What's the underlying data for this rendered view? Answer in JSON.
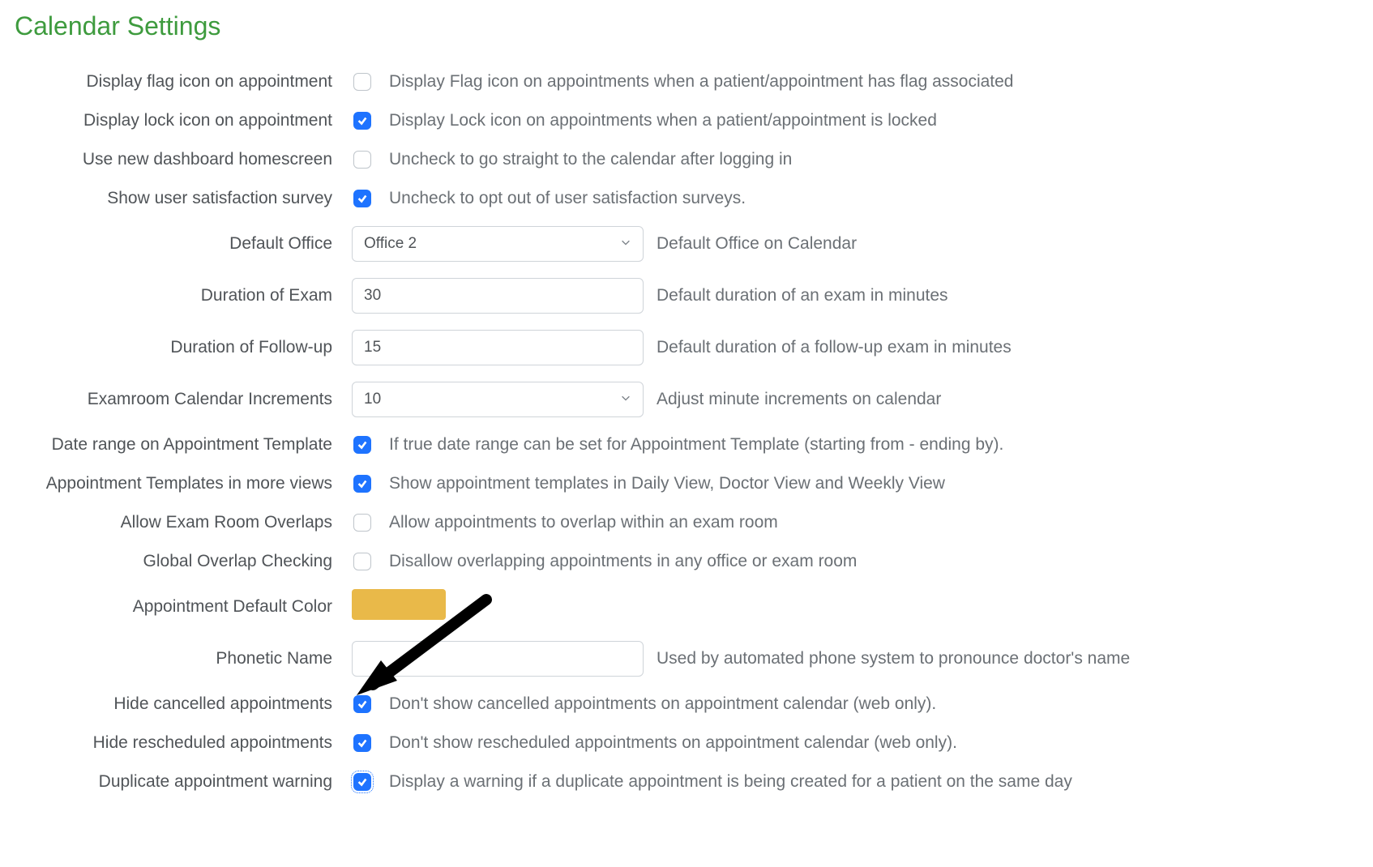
{
  "title": "Calendar Settings",
  "colors": {
    "accent": "#1e73ff",
    "title": "#3e9b3e",
    "swatch": "#e9b949"
  },
  "rows": {
    "flag": {
      "label": "Display flag icon on appointment",
      "checked": false,
      "desc": "Display Flag icon on appointments when a patient/appointment has flag associated"
    },
    "lock": {
      "label": "Display lock icon on appointment",
      "checked": true,
      "desc": "Display Lock icon on appointments when a patient/appointment is locked"
    },
    "dashboard": {
      "label": "Use new dashboard homescreen",
      "checked": false,
      "desc": "Uncheck to go straight to the calendar after logging in"
    },
    "survey": {
      "label": "Show user satisfaction survey",
      "checked": true,
      "desc": "Uncheck to opt out of user satisfaction surveys."
    },
    "default_office": {
      "label": "Default Office",
      "value": "Office 2",
      "desc": "Default Office on Calendar"
    },
    "duration_exam": {
      "label": "Duration of Exam",
      "value": "30",
      "desc": "Default duration of an exam in minutes"
    },
    "duration_followup": {
      "label": "Duration of Follow-up",
      "value": "15",
      "desc": "Default duration of a follow-up exam in minutes"
    },
    "increments": {
      "label": "Examroom Calendar Increments",
      "value": "10",
      "desc": "Adjust minute increments on calendar"
    },
    "date_range_template": {
      "label": "Date range on Appointment Template",
      "checked": true,
      "desc": "If true date range can be set for Appointment Template (starting from - ending by)."
    },
    "templates_more_views": {
      "label": "Appointment Templates in more views",
      "checked": true,
      "desc": "Show appointment templates in Daily View, Doctor View and Weekly View"
    },
    "allow_overlaps": {
      "label": "Allow Exam Room Overlaps",
      "checked": false,
      "desc": "Allow appointments to overlap within an exam room"
    },
    "global_overlap": {
      "label": "Global Overlap Checking",
      "checked": false,
      "desc": "Disallow overlapping appointments in any office or exam room"
    },
    "default_color": {
      "label": "Appointment Default Color",
      "value": "#e9b949"
    },
    "phonetic": {
      "label": "Phonetic Name",
      "value": "",
      "desc": "Used by automated phone system to pronounce doctor's name"
    },
    "hide_cancelled": {
      "label": "Hide cancelled appointments",
      "checked": true,
      "desc": "Don't show cancelled appointments on appointment calendar (web only)."
    },
    "hide_rescheduled": {
      "label": "Hide rescheduled appointments",
      "checked": true,
      "desc": "Don't show rescheduled appointments on appointment calendar (web only)."
    },
    "duplicate_warning": {
      "label": "Duplicate appointment warning",
      "checked": true,
      "desc": "Display a warning if a duplicate appointment is being created for a patient on the same day"
    }
  }
}
